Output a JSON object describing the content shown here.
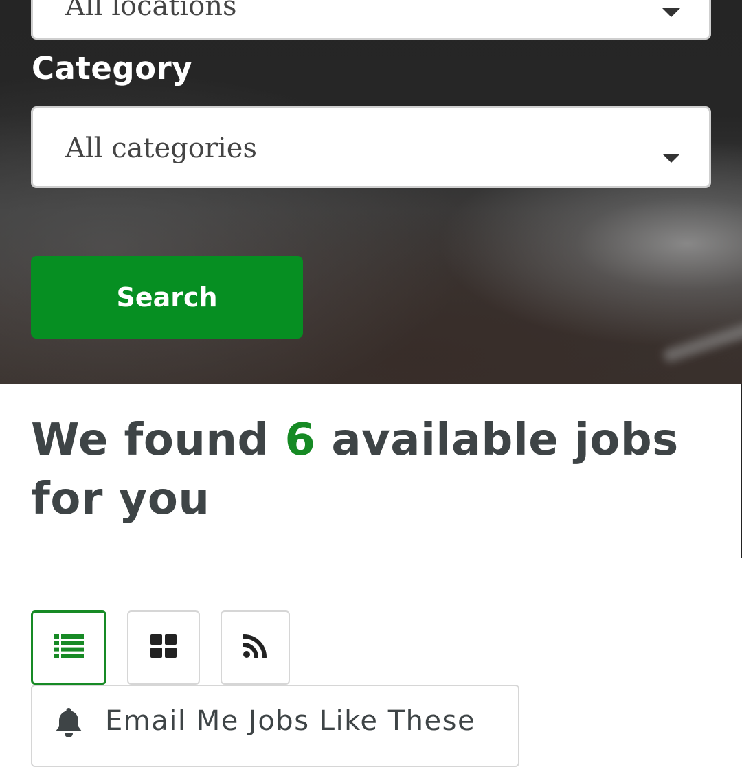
{
  "filters": {
    "location": {
      "selected": "All locations",
      "caret_icon": "caret-down-icon"
    },
    "category": {
      "label": "Category",
      "selected": "All categories",
      "caret_icon": "caret-down-icon"
    },
    "search_button_label": "Search"
  },
  "results": {
    "heading_prefix": "We found",
    "count": "6",
    "heading_suffix": "available jobs for you"
  },
  "view_options": [
    {
      "name": "list-view",
      "icon": "list-icon",
      "active": true
    },
    {
      "name": "grid-view",
      "icon": "grid-icon",
      "active": false
    },
    {
      "name": "rss-feed",
      "icon": "rss-icon",
      "active": false
    }
  ],
  "alert": {
    "icon": "bell-icon",
    "label": "Email Me Jobs Like These"
  },
  "colors": {
    "accent_green": "#068f22",
    "heading_text": "#3e4446",
    "hero_background": "#262626"
  }
}
